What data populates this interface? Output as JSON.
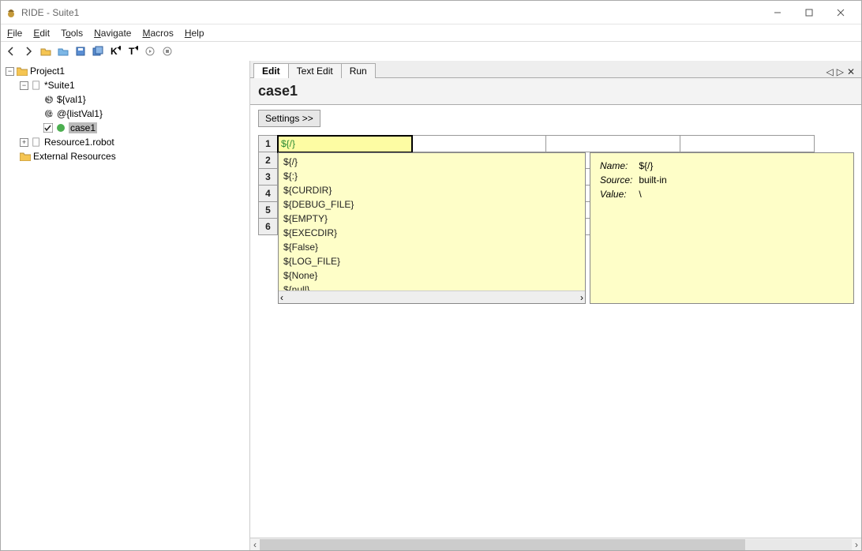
{
  "window": {
    "title": "RIDE - Suite1"
  },
  "menu": [
    "File",
    "Edit",
    "Tools",
    "Navigate",
    "Macros",
    "Help"
  ],
  "tree": {
    "root": "Project1",
    "suite": "*Suite1",
    "var1": "${val1}",
    "var2": "@{listVal1}",
    "case": "case1",
    "resource": "Resource1.robot",
    "ext": "External Resources"
  },
  "tabs": {
    "edit": "Edit",
    "textedit": "Text Edit",
    "run": "Run"
  },
  "case": {
    "title": "case1",
    "settingsBtn": "Settings >>",
    "cellValue": "${/}",
    "rows": [
      "1",
      "2",
      "3",
      "4",
      "5",
      "6"
    ]
  },
  "suggestions": [
    "${/}",
    "${:}",
    "${CURDIR}",
    "${DEBUG_FILE}",
    "${EMPTY}",
    "${EXECDIR}",
    "${False}",
    "${LOG_FILE}",
    "${None}",
    "${null}"
  ],
  "tooltip": {
    "nameK": "Name:",
    "nameV": "${/}",
    "sourceK": "Source:",
    "sourceV": "built-in",
    "valueK": "Value:",
    "valueV": "\\"
  }
}
